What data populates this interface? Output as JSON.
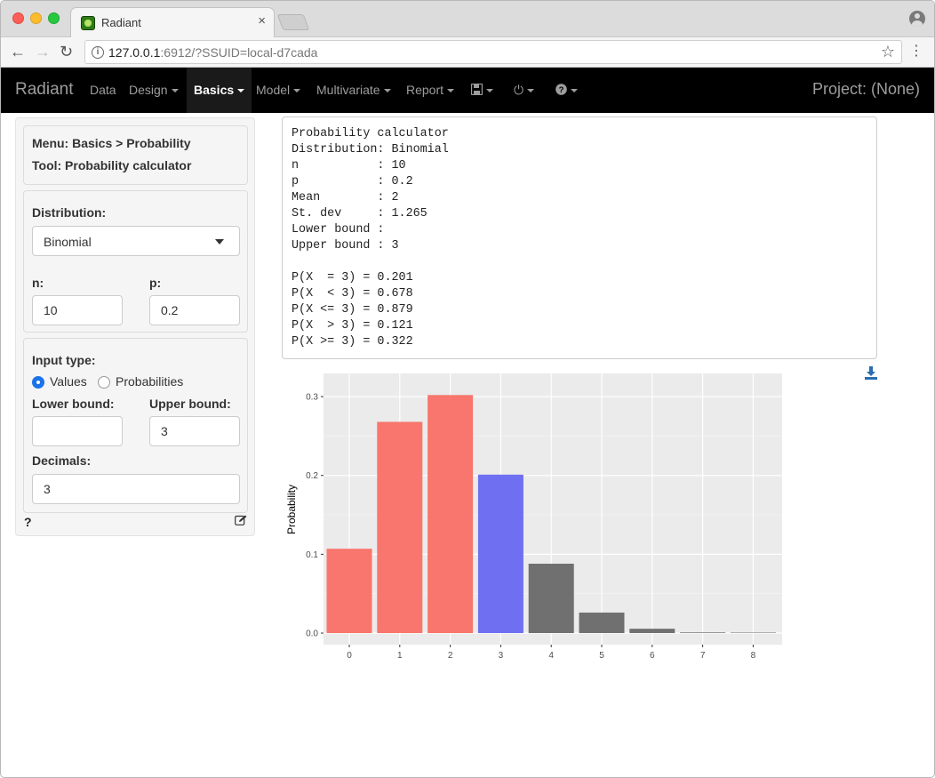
{
  "browser": {
    "tab_title": "Radiant",
    "tab_close": "×",
    "url_host": "127.0.0.1",
    "url_rest": ":6912/?SSUID=local-d7cada"
  },
  "navbar": {
    "brand": "Radiant",
    "items": [
      "Data",
      "Design",
      "Basics",
      "Model",
      "Multivariate",
      "Report"
    ],
    "active": "Basics",
    "project": "Project: (None)"
  },
  "sidebar": {
    "menu": "Menu: Basics > Probability",
    "tool": "Tool: Probability calculator",
    "distribution_label": "Distribution:",
    "distribution_value": "Binomial",
    "n_label": "n:",
    "n_value": "10",
    "p_label": "p:",
    "p_value": "0.2",
    "input_type_label": "Input type:",
    "radio_values": "Values",
    "radio_probabilities": "Probabilities",
    "lower_bound_label": "Lower bound:",
    "lower_bound_value": "",
    "upper_bound_label": "Upper bound:",
    "upper_bound_value": "3",
    "decimals_label": "Decimals:",
    "decimals_value": "3",
    "help": "?"
  },
  "output": {
    "text": "Probability calculator\nDistribution: Binomial\nn           : 10\np           : 0.2\nMean        : 2\nSt. dev     : 1.265\nLower bound :\nUpper bound : 3\n\nP(X  = 3) = 0.201\nP(X  < 3) = 0.678\nP(X <= 3) = 0.879\nP(X  > 3) = 0.121\nP(X >= 3) = 0.322"
  },
  "colors": {
    "below": "#f8766d",
    "equal": "#6f6ff2",
    "above": "#707070",
    "panel": "#ebebeb"
  },
  "chart_data": {
    "type": "bar",
    "categories": [
      "0",
      "1",
      "2",
      "3",
      "4",
      "5",
      "6",
      "7",
      "8"
    ],
    "values": [
      0.107,
      0.268,
      0.302,
      0.201,
      0.088,
      0.026,
      0.0055,
      0.0008,
      0.0001
    ],
    "groups": [
      "below",
      "below",
      "below",
      "equal",
      "above",
      "above",
      "above",
      "above",
      "above"
    ],
    "ylabel": "Probability",
    "xlabel": "",
    "yticks": [
      "0.0",
      "0.1",
      "0.2",
      "0.3"
    ],
    "ylim": [
      0,
      0.317
    ],
    "grid": true,
    "legend": "none"
  }
}
